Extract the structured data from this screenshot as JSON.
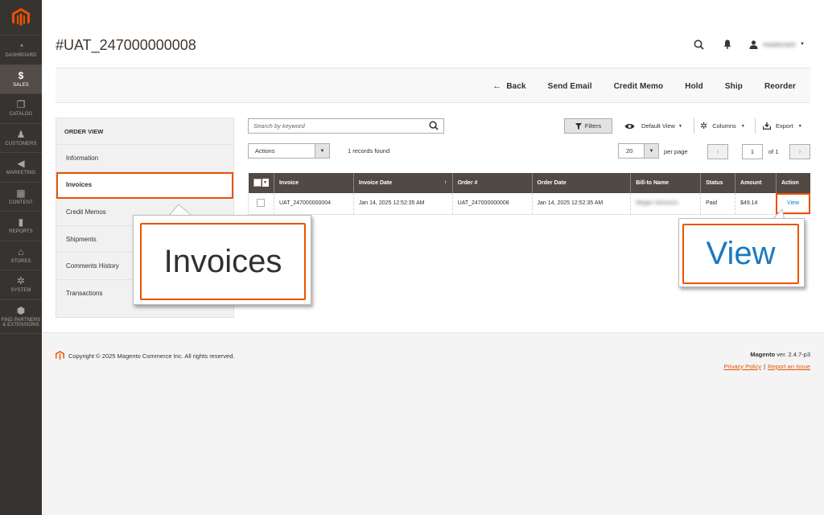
{
  "nav": {
    "items": [
      {
        "label": "DASHBOARD",
        "icon": "dashboard-icon",
        "glyph": "◔"
      },
      {
        "label": "SALES",
        "icon": "dollar-icon",
        "glyph": "$"
      },
      {
        "label": "CATALOG",
        "icon": "cube-icon",
        "glyph": "❒"
      },
      {
        "label": "CUSTOMERS",
        "icon": "person-icon",
        "glyph": "♟"
      },
      {
        "label": "MARKETING",
        "icon": "megaphone-icon",
        "glyph": "◀"
      },
      {
        "label": "CONTENT",
        "icon": "layout-icon",
        "glyph": "▦"
      },
      {
        "label": "REPORTS",
        "icon": "bar-chart-icon",
        "glyph": "▮"
      },
      {
        "label": "STORES",
        "icon": "store-icon",
        "glyph": "⌂"
      },
      {
        "label": "SYSTEM",
        "icon": "gear-icon",
        "glyph": "✲"
      },
      {
        "label": "FIND PARTNERS & EXTENSIONS",
        "icon": "box-icon",
        "glyph": "⬢"
      }
    ]
  },
  "header": {
    "title": "#UAT_247000000008",
    "user_name": "mastercard"
  },
  "action_bar": {
    "back": "Back",
    "send_email": "Send Email",
    "credit_memo": "Credit Memo",
    "hold": "Hold",
    "ship": "Ship",
    "reorder": "Reorder"
  },
  "order_view": {
    "heading": "ORDER VIEW",
    "items": [
      "Information",
      "Invoices",
      "Credit Memos",
      "Shipments",
      "Comments History",
      "Transactions"
    ]
  },
  "grid_toolbar": {
    "search_placeholder": "Search by keyword",
    "filters": "Filters",
    "default_view": "Default View",
    "columns": "Columns",
    "export": "Export",
    "actions": "Actions",
    "records_found": "1 records found",
    "per_page_value": "20",
    "per_page_label": "per page",
    "page_value": "1",
    "page_of": "of 1"
  },
  "table": {
    "columns": [
      "Invoice",
      "Invoice Date",
      "Order #",
      "Order Date",
      "Bill-to Name",
      "Status",
      "Amount",
      "Action"
    ],
    "rows": [
      {
        "invoice": "UAT_247000000004",
        "invoice_date": "Jan 14, 2025 12:52:35 AM",
        "order": "UAT_247000000008",
        "order_date": "Jan 14, 2025 12:52:35 AM",
        "bill_to": "Megan Simmons",
        "status": "Paid",
        "amount": "$49.14",
        "action": "View"
      }
    ]
  },
  "callouts": {
    "invoices": "Invoices",
    "view": "View"
  },
  "footer": {
    "copyright": "Copyright © 2025 Magento Commerce Inc. All rights reserved.",
    "brand": "Magento",
    "version": " ver. 2.4.7-p3",
    "privacy": "Privacy Policy",
    "separator": "|",
    "report": "Report an Issue"
  },
  "colors": {
    "accent": "#eb5202",
    "nav_bg": "#373330",
    "table_header": "#514943",
    "link": "#007bdb"
  }
}
